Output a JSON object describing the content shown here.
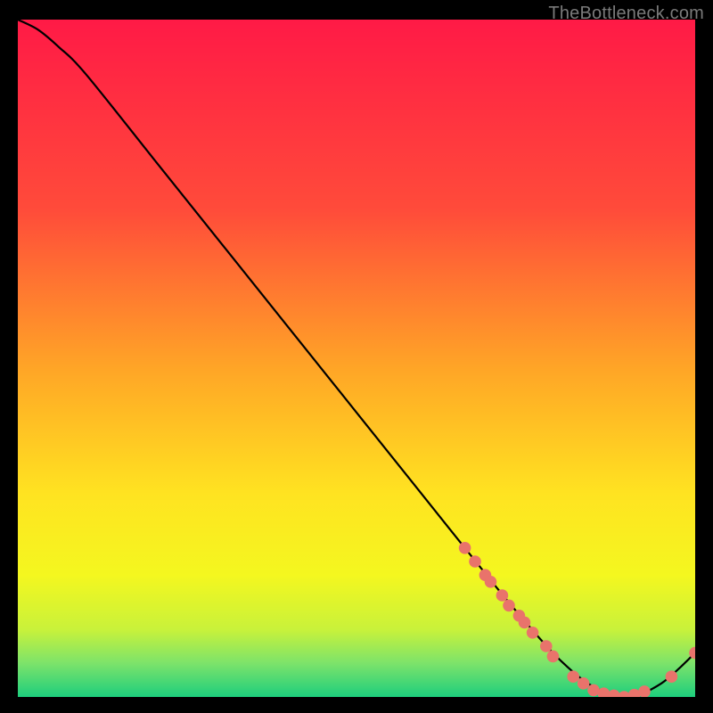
{
  "watermark": "TheBottleneck.com",
  "chart_data": {
    "type": "line",
    "title": "",
    "xlabel": "",
    "ylabel": "",
    "xlim": [
      0,
      100
    ],
    "ylim": [
      0,
      100
    ],
    "grid": false,
    "gradient_stops": [
      {
        "offset": 0,
        "color": "#ff1a46"
      },
      {
        "offset": 28,
        "color": "#ff4b3a"
      },
      {
        "offset": 52,
        "color": "#ffa726"
      },
      {
        "offset": 70,
        "color": "#ffe321"
      },
      {
        "offset": 82,
        "color": "#f4f71f"
      },
      {
        "offset": 90,
        "color": "#c9f23a"
      },
      {
        "offset": 95,
        "color": "#7de36a"
      },
      {
        "offset": 100,
        "color": "#1dce7d"
      }
    ],
    "series": [
      {
        "name": "bottleneck-curve",
        "color": "#000000",
        "x": [
          0.0,
          3.0,
          6.0,
          10.0,
          20.0,
          30.0,
          40.0,
          50.0,
          60.0,
          70.0,
          75.0,
          80.0,
          85.0,
          90.0,
          95.0,
          100.0
        ],
        "y": [
          100.0,
          98.5,
          96.0,
          92.0,
          79.5,
          67.0,
          54.5,
          42.0,
          29.5,
          17.0,
          11.0,
          5.5,
          1.5,
          0.0,
          2.0,
          6.5
        ]
      }
    ],
    "markers": {
      "color": "#e9736b",
      "points": [
        {
          "x": 66.0,
          "y": 22.0
        },
        {
          "x": 67.5,
          "y": 20.0
        },
        {
          "x": 69.0,
          "y": 18.0
        },
        {
          "x": 69.8,
          "y": 17.0
        },
        {
          "x": 71.5,
          "y": 15.0
        },
        {
          "x": 72.5,
          "y": 13.5
        },
        {
          "x": 74.0,
          "y": 12.0
        },
        {
          "x": 74.8,
          "y": 11.0
        },
        {
          "x": 76.0,
          "y": 9.5
        },
        {
          "x": 78.0,
          "y": 7.5
        },
        {
          "x": 79.0,
          "y": 6.0
        },
        {
          "x": 82.0,
          "y": 3.0
        },
        {
          "x": 83.5,
          "y": 2.0
        },
        {
          "x": 85.0,
          "y": 1.0
        },
        {
          "x": 86.5,
          "y": 0.5
        },
        {
          "x": 88.0,
          "y": 0.2
        },
        {
          "x": 89.5,
          "y": 0.0
        },
        {
          "x": 91.0,
          "y": 0.3
        },
        {
          "x": 92.5,
          "y": 0.8
        },
        {
          "x": 96.5,
          "y": 3.0
        },
        {
          "x": 100.0,
          "y": 6.5
        }
      ]
    }
  }
}
